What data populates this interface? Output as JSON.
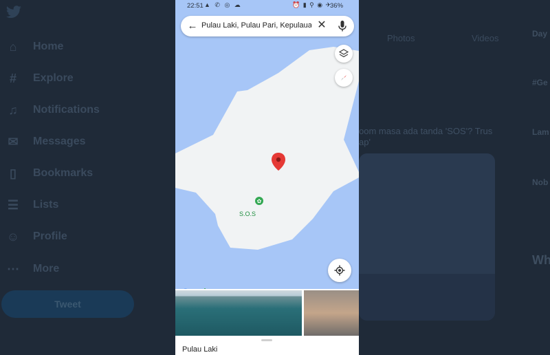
{
  "twitter": {
    "nav": [
      {
        "label": "Home",
        "icon": "home-icon"
      },
      {
        "label": "Explore",
        "icon": "hashtag-icon"
      },
      {
        "label": "Notifications",
        "icon": "bell-icon"
      },
      {
        "label": "Messages",
        "icon": "mail-icon"
      },
      {
        "label": "Bookmarks",
        "icon": "bookmark-icon"
      },
      {
        "label": "Lists",
        "icon": "list-icon"
      },
      {
        "label": "Profile",
        "icon": "person-icon"
      },
      {
        "label": "More",
        "icon": "more-icon"
      }
    ],
    "tweet_button": "Tweet",
    "tabs": [
      "Photos",
      "Videos"
    ],
    "tweet_text": "oom masa ada tanda 'SOS'? Trus ap'",
    "trends": [
      "Day",
      "#Ge",
      "Lam",
      "Nob"
    ],
    "who_to_follow": "Wh"
  },
  "phone": {
    "status": {
      "time": "22:51",
      "left_icons": "▲ ✆ ◎ ☁",
      "right_icons": "⏰ ▮ ⚲ ◉ ✈",
      "battery": "36%"
    },
    "search": {
      "query": "Pulau Laki, Pulau Pari, Kepulaua...",
      "back_icon": "arrow-back-icon",
      "clear_icon": "close-icon",
      "mic_icon": "mic-icon"
    },
    "map": {
      "poi_label": "S.O.S",
      "attribution": "Google",
      "land_color": "#f1f3f4",
      "water_color": "#a7c6f7",
      "pin_color": "#e53935",
      "poi_color": "#34a853"
    },
    "place_name": "Pulau Laki"
  }
}
